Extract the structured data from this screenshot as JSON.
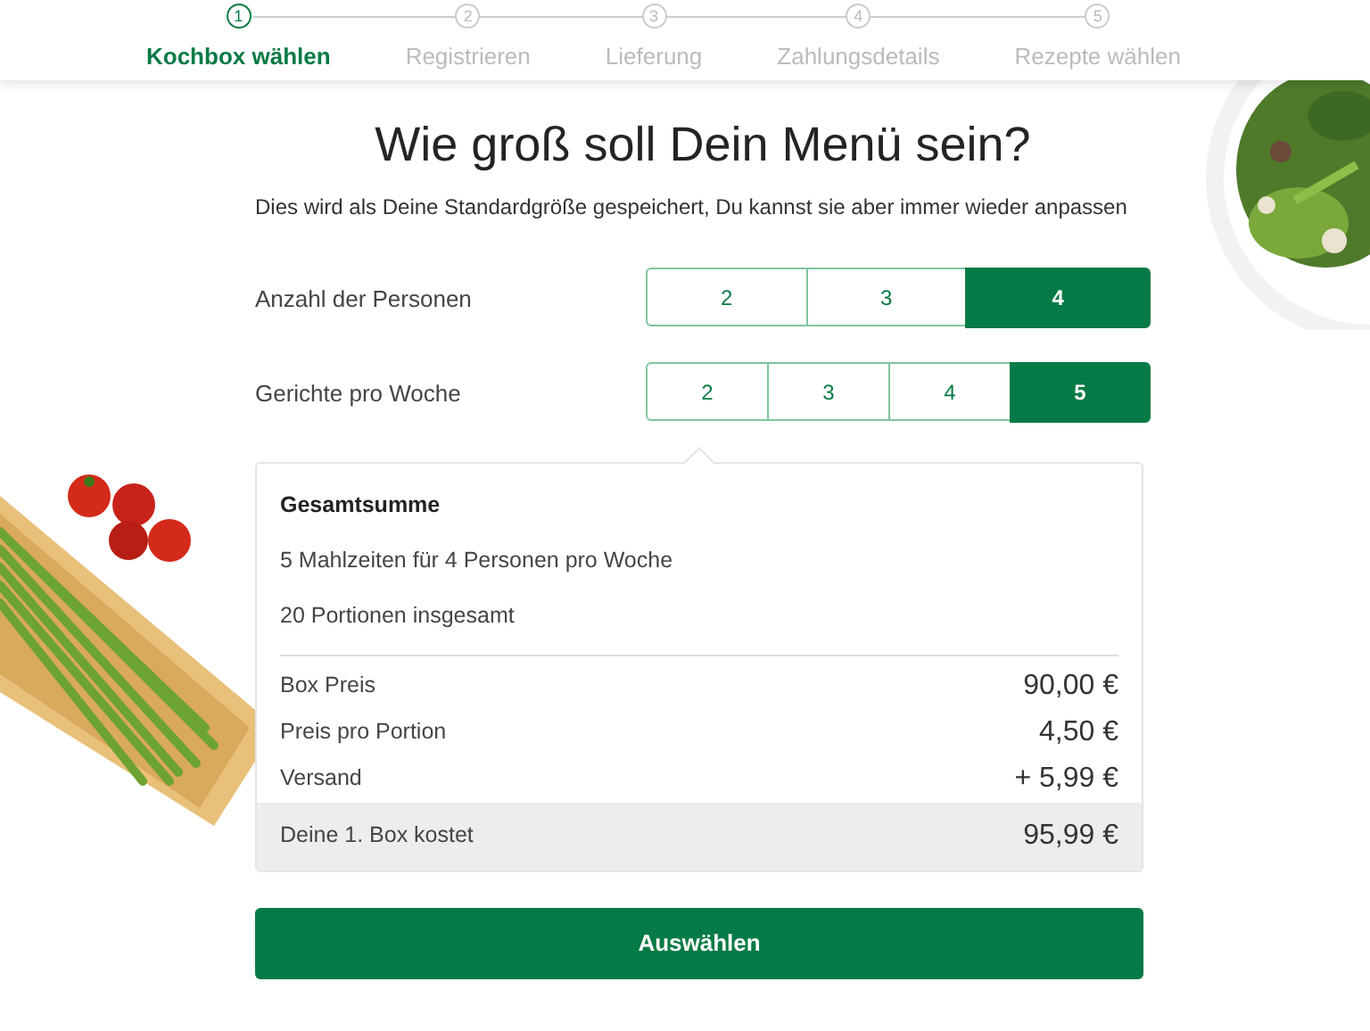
{
  "steps": [
    {
      "number": "1",
      "label": "Kochbox wählen",
      "selected": true
    },
    {
      "number": "2",
      "label": "Registrieren",
      "selected": false
    },
    {
      "number": "3",
      "label": "Lieferung",
      "selected": false
    },
    {
      "number": "4",
      "label": "Zahlungsdetails",
      "selected": false
    },
    {
      "number": "5",
      "label": "Rezepte wählen",
      "selected": false
    }
  ],
  "title": "Wie groß soll Dein Menü sein?",
  "subtitle": "Dies wird als Deine Standardgröße gespeichert, Du kannst sie aber immer wieder anpassen",
  "selectors": [
    {
      "label": "Anzahl der Personen",
      "options": [
        {
          "label": "2",
          "selected": false
        },
        {
          "label": "3",
          "selected": false
        },
        {
          "label": "4",
          "selected": true
        }
      ]
    },
    {
      "label": "Gerichte pro Woche",
      "options": [
        {
          "label": "2",
          "selected": false
        },
        {
          "label": "3",
          "selected": false
        },
        {
          "label": "4",
          "selected": false
        },
        {
          "label": "5",
          "selected": true
        }
      ]
    }
  ],
  "summary": {
    "heading": "Gesamtsumme",
    "lines": [
      "5 Mahlzeiten für 4 Personen pro Woche",
      "20 Portionen insgesamt"
    ],
    "prices": [
      {
        "label": "Box Preis",
        "value": "90,00 €"
      },
      {
        "label": "Preis pro Portion",
        "value": "4,50 €"
      },
      {
        "label": "Versand",
        "value": "+ 5,99 €"
      }
    ],
    "total": {
      "label": "Deine 1. Box kostet",
      "value": "95,99 €"
    }
  },
  "button": "Auswählen"
}
